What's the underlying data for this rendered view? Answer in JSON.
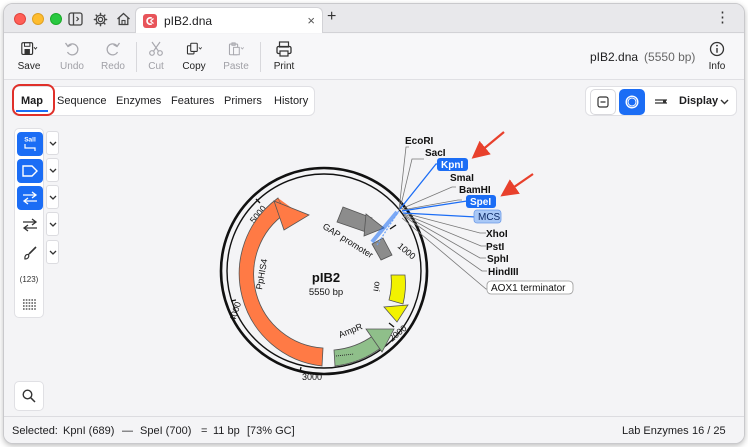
{
  "tab": {
    "title": "pIB2.dna",
    "close": "×",
    "new": "+"
  },
  "toolbar": {
    "save": "Save",
    "undo": "Undo",
    "redo": "Redo",
    "cut": "Cut",
    "copy": "Copy",
    "paste": "Paste",
    "print": "Print",
    "info": "Info",
    "file_name": "pIB2.dna",
    "file_size": "(5550 bp)"
  },
  "view_tabs": [
    "Map",
    "Sequence",
    "Enzymes",
    "Features",
    "Primers",
    "History"
  ],
  "display_label": "Display",
  "palette": {
    "enzyme_button_label": "SalI",
    "counter": "(123)"
  },
  "map": {
    "name": "pIB2",
    "length": "5550 bp",
    "ticks": [
      "1000",
      "2000",
      "3000",
      "4000",
      "5000"
    ],
    "features": [
      {
        "label": "GAP promoter",
        "color": "#8c8c8c"
      },
      {
        "label": "ori",
        "color": "#f2f200"
      },
      {
        "label": "AmpR",
        "color": "#8fbf8a"
      },
      {
        "label": "PpHIS4",
        "color": "#ff7a45"
      }
    ],
    "enzymes": [
      "EcoRI",
      "SacI",
      "KpnI",
      "SmaI",
      "BamHI",
      "SpeI",
      "MCS",
      "XhoI",
      "PstI",
      "SphI",
      "HindIII",
      "AOX1 terminator"
    ]
  },
  "colors": {
    "accent": "#1b6df5",
    "highlight": "#e0302a",
    "arrow": "#e8402c"
  },
  "status": {
    "selected_label": "Selected:",
    "from": "KpnI (689)",
    "dash": "—",
    "to": "SpeI (700)",
    "equals": "=",
    "length": "11 bp",
    "gc": "[73% GC]",
    "enzyme_set": "Lab Enzymes",
    "count": "16 / 25"
  }
}
